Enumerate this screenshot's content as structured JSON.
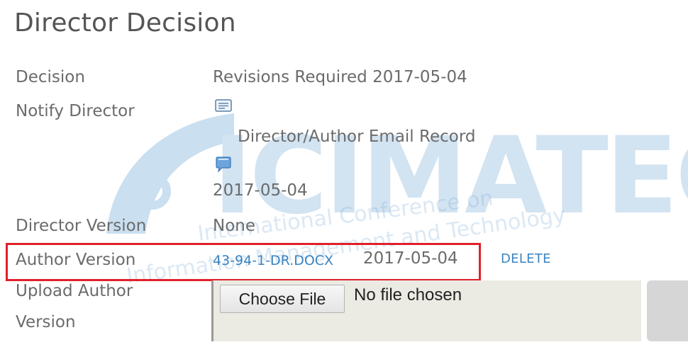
{
  "page": {
    "title": "Director Decision"
  },
  "rows": {
    "decision": {
      "label": "Decision",
      "value": "Revisions Required 2017-05-04"
    },
    "notify": {
      "label": "Notify Director",
      "email_record": "Director/Author Email Record",
      "date": "2017-05-04"
    },
    "director_version": {
      "label": "Director Version",
      "value": "None"
    },
    "author_version": {
      "label": "Author Version",
      "file_link": "43-94-1-DR.DOCX",
      "date": "2017-05-04",
      "delete_label": "DELETE"
    },
    "upload_author_version": {
      "label_line1": "Upload Author",
      "label_line2": "Version",
      "choose_file_label": "Choose File",
      "file_status": "No file chosen"
    }
  },
  "watermark": {
    "logo_text_1": "ICIMATECH",
    "arc_text": "International Conference on",
    "arc_text_2": "Information Management and Technology"
  },
  "icons": {
    "mail": "envelope-icon",
    "chat": "speech-bubble-icon"
  },
  "colors": {
    "link": "#3a83c2",
    "highlight_border": "#e0202a",
    "watermark": "#cfe2f1"
  }
}
